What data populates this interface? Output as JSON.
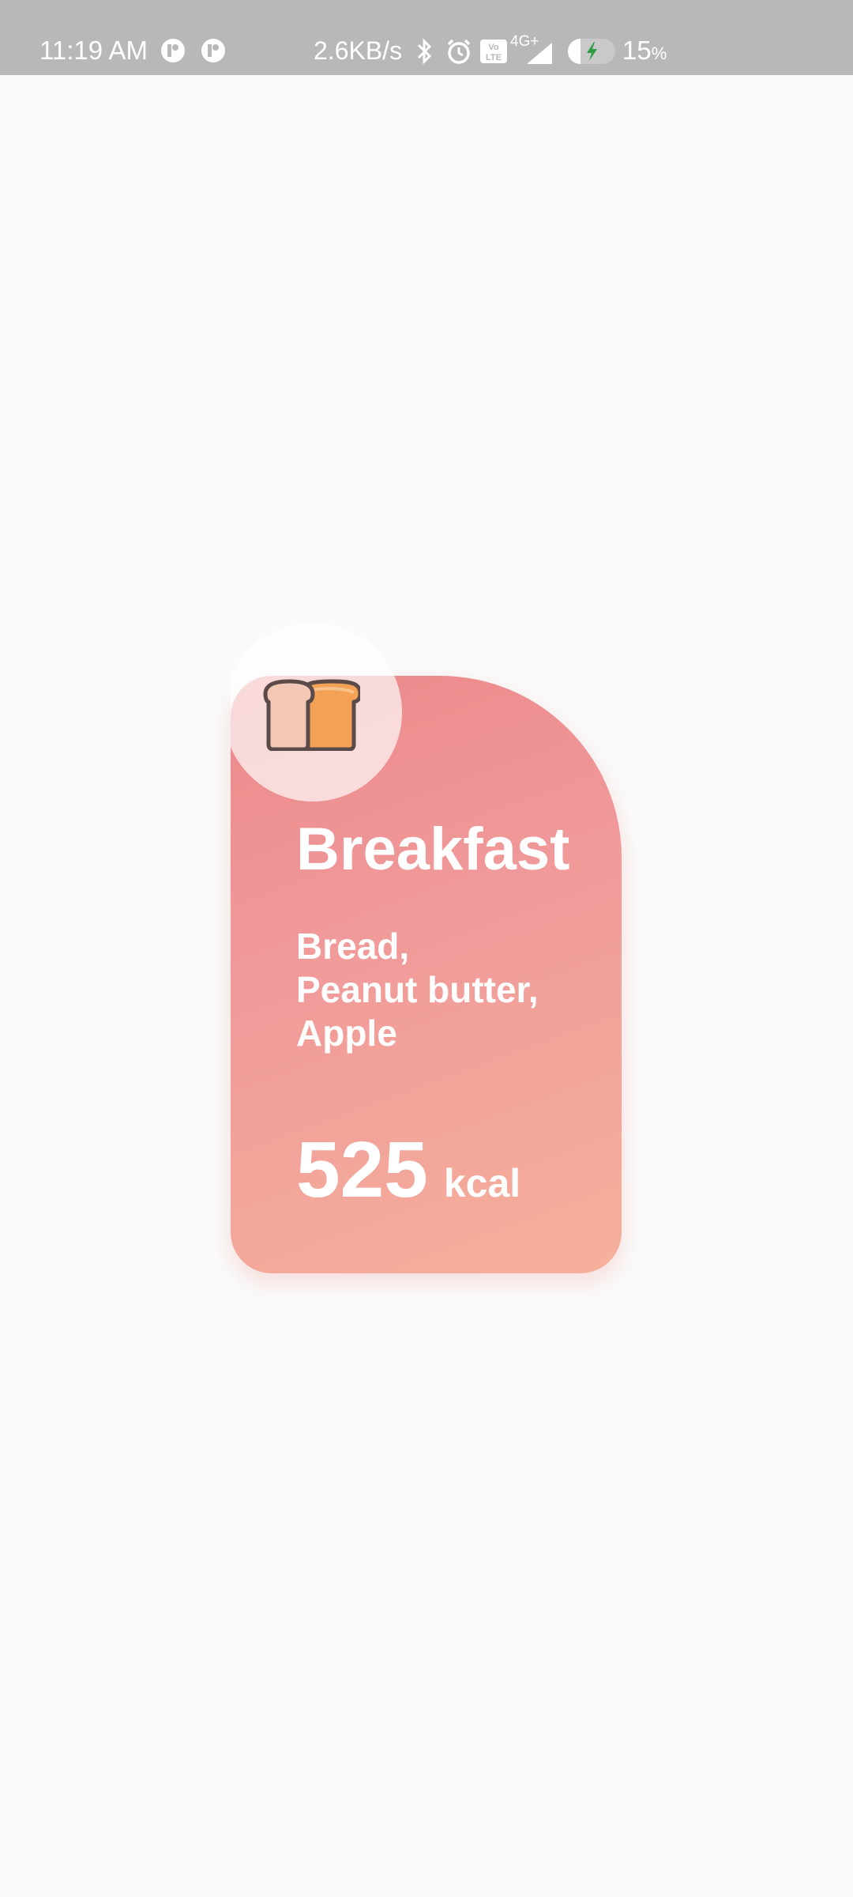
{
  "status_bar": {
    "time": "11:19 AM",
    "net_speed": "2.6KB/s",
    "volte": "Vo LTE",
    "network": "4G+",
    "battery_percent": "15",
    "battery_unit": "%",
    "icons": [
      "app-notification-icon",
      "app-notification-icon",
      "bluetooth-icon",
      "alarm-icon",
      "volte-icon",
      "signal-icon",
      "battery-charging-icon"
    ]
  },
  "meal_card": {
    "title": "Breakfast",
    "icon": "bread-icon",
    "foods": [
      "Bread,",
      "Peanut butter,",
      "Apple"
    ],
    "calories": "525",
    "calories_unit": "kcal",
    "colors": {
      "gradient_start": "#ec888a",
      "gradient_end": "#f5b09b",
      "text": "#ffffff"
    }
  }
}
